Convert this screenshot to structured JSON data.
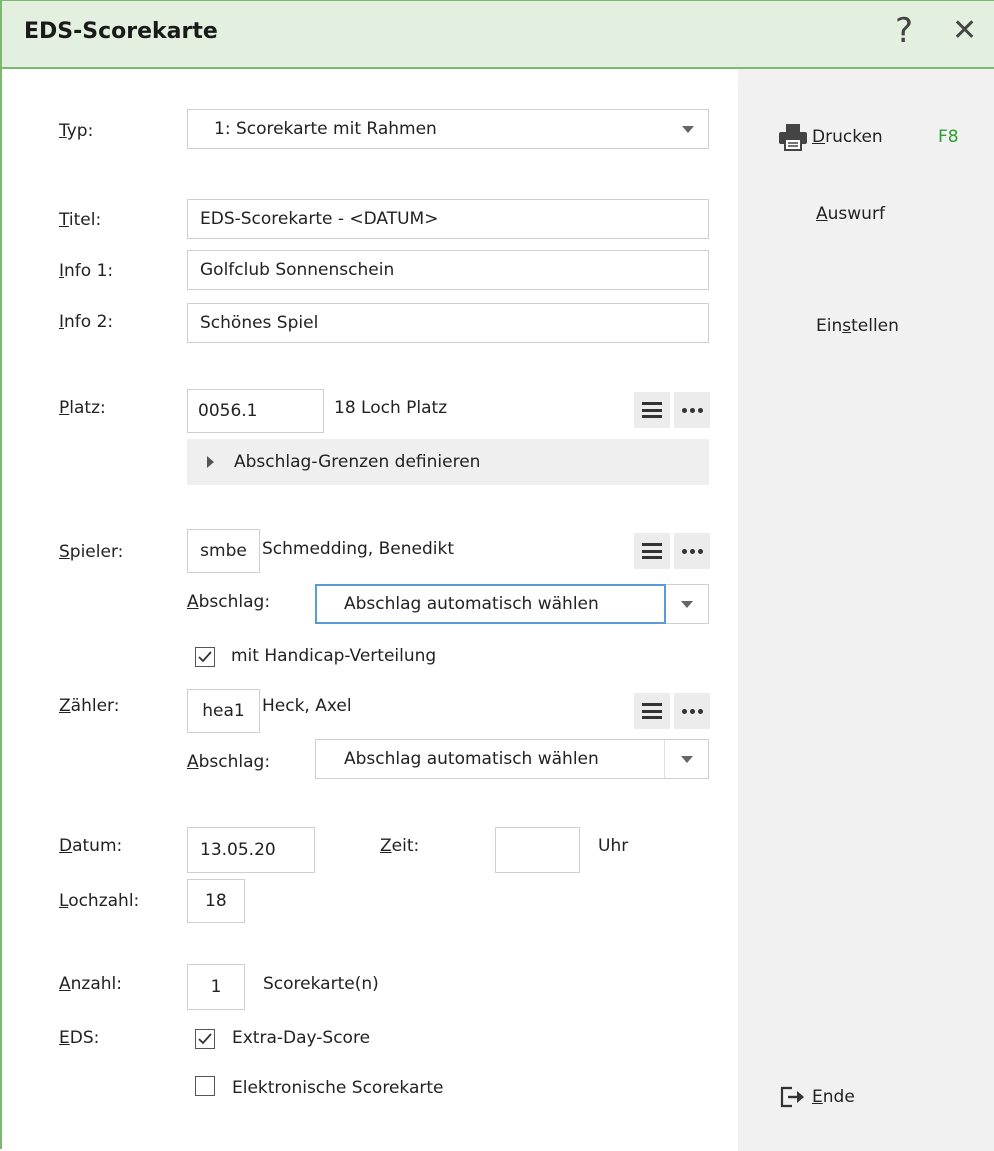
{
  "window": {
    "title": "EDS-Scorekarte",
    "help_glyph": "?",
    "close_glyph": "✕"
  },
  "form": {
    "typ": {
      "label_u": "T",
      "label_rest": "yp:",
      "value": "1: Scorekarte mit Rahmen"
    },
    "titel": {
      "label_u": "T",
      "label_rest": "itel:",
      "value": "EDS-Scorekarte - <DATUM>"
    },
    "info1": {
      "label_u": "I",
      "label_rest": "nfo 1:",
      "value": "Golfclub Sonnenschein"
    },
    "info2": {
      "label_u": "I",
      "label_rest": "nfo 2:",
      "value": "Schönes Spiel"
    },
    "platz": {
      "label_u": "P",
      "label_rest": "latz:",
      "code": "0056.1",
      "name": "18 Loch Platz"
    },
    "abschlag_grenzen": "Abschlag-Grenzen definieren",
    "spieler": {
      "label_u": "S",
      "label_rest": "pieler:",
      "code": "smbe",
      "name": "Schmedding, Benedikt",
      "abschlag_label_u": "A",
      "abschlag_label_rest": "bschlag:",
      "abschlag_value": "Abschlag automatisch wählen",
      "handicap_label": "mit Handicap-Verteilung",
      "handicap_checked": true
    },
    "zaehler": {
      "label_u": "Z",
      "label_rest": "ähler:",
      "code": "hea1",
      "name": "Heck, Axel",
      "abschlag_label_u": "A",
      "abschlag_label_rest": "bschlag:",
      "abschlag_value": "Abschlag automatisch wählen"
    },
    "datum": {
      "label_u": "D",
      "label_rest": "atum:",
      "value": "13.05.20"
    },
    "zeit": {
      "label_u": "Z",
      "label_rest": "eit:",
      "value": "",
      "unit": "Uhr"
    },
    "lochzahl": {
      "label_u": "L",
      "label_rest": "ochzahl:",
      "value": "18"
    },
    "anzahl": {
      "label_u": "A",
      "label_rest": "nzahl:",
      "value": "1",
      "unit": "Scorekarte(n)"
    },
    "eds": {
      "label_u": "E",
      "label_rest": "DS:",
      "extra_day_label": "Extra-Day-Score",
      "extra_day_checked": true,
      "elektronisch_label": "Elektronische Scorekarte",
      "elektronisch_checked": false
    }
  },
  "actions": {
    "drucken": {
      "label_u": "D",
      "label_rest": "rucken",
      "shortcut": "F8"
    },
    "auswurf": {
      "label_u": "A",
      "label_rest": "uswurf"
    },
    "einstellen": {
      "label_pre": "Ein",
      "label_u": "s",
      "label_rest": "tellen"
    },
    "ende": {
      "label_u": "E",
      "label_rest": "nde"
    }
  },
  "colors": {
    "accent_green": "#7cb870",
    "titlebar_bg": "#e4f0df",
    "shortcut_green": "#2e9e2e",
    "focus_blue": "#5b9bd5"
  }
}
